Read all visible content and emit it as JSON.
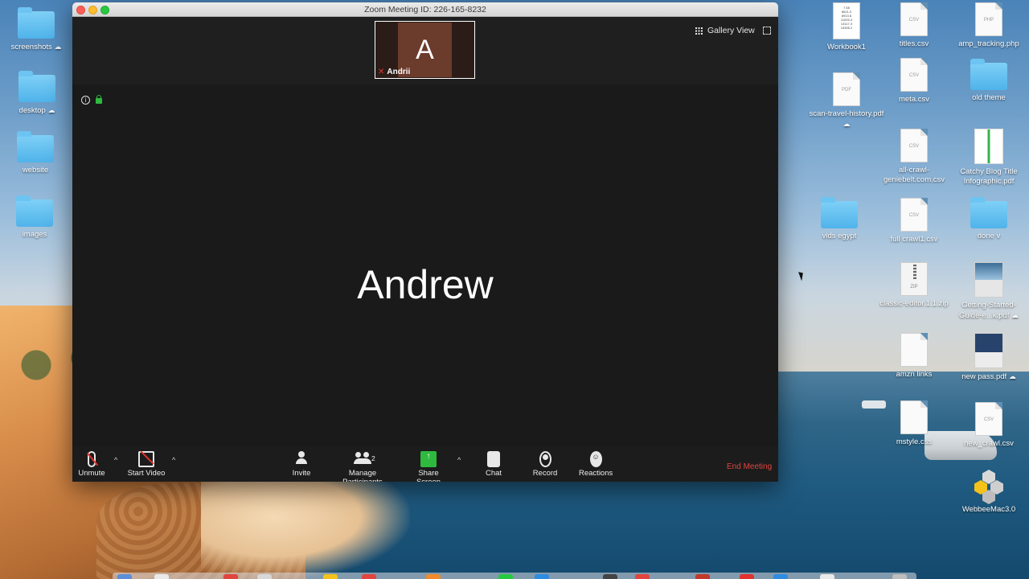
{
  "window": {
    "title": "Zoom Meeting ID: 226-165-8232"
  },
  "meeting": {
    "thumbnail": {
      "initial": "A",
      "name": "Andrii"
    },
    "view_label": "Gallery View",
    "active_speaker": "Andrew"
  },
  "toolbar": {
    "unmute": "Unmute",
    "start_video": "Start Video",
    "invite": "Invite",
    "manage_participants": "Manage Participants",
    "participant_count": "2",
    "share_screen": "Share Screen",
    "share_glyph": "↑",
    "chat": "Chat",
    "record": "Record",
    "reactions": "Reactions",
    "reaction_glyph": "☺",
    "end_meeting": "End Meeting",
    "caret": "^"
  },
  "desktop": {
    "left_icons": [
      {
        "label": "screenshots",
        "cloud": "☁"
      },
      {
        "label": "desktop",
        "cloud": "☁"
      },
      {
        "label": "website"
      },
      {
        "label": "images"
      }
    ],
    "right_icons": {
      "workbook": "Workbook1",
      "titles": "titles.csv",
      "amp_tracking": "amp_tracking.php",
      "scan_travel": "scan-travel-history.pdf",
      "meta": "meta.csv",
      "old_theme": "old theme",
      "all_crawl": "all-crawl-geniebelt.com.csv",
      "catchy_blog": "Catchy Blog Title Infographic.pdf",
      "vids_egypt": "vids egypt",
      "full_crawl": "full crawl1.csv",
      "done_v": "done v",
      "classic_editor": "classic-editor.1.1.zip",
      "getting_started": "Getting-Started-Guide-e...k.pdf",
      "amzn_links": "amzn links",
      "new_pass": "new pass.pdf",
      "mstyle": "mstyle.css",
      "new_crawl": "new_crawl.csv",
      "webbee": "WebbeeMac3.0"
    },
    "file_badges": {
      "csv": "CSV",
      "php": "PHP",
      "pdf": "PDF",
      "zip": "ZIP"
    },
    "cloud_glyph": "☁"
  },
  "colors": {
    "end_meeting": "#e0453f",
    "share_green": "#2fba3f",
    "muted_red": "#e0332f",
    "meeting_bg": "#1a1a1a"
  }
}
